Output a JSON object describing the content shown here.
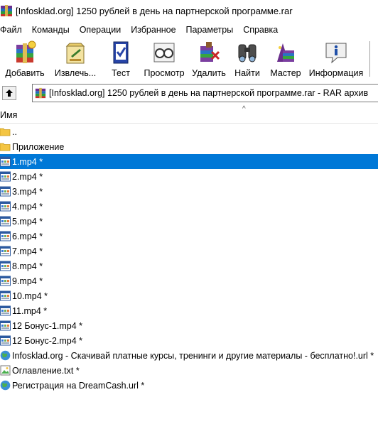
{
  "window": {
    "title": "[Infosklad.org] 1250 рублей в день на партнерской программе.rar"
  },
  "menu": [
    "Файл",
    "Команды",
    "Операции",
    "Избранное",
    "Параметры",
    "Справка"
  ],
  "toolbar": [
    {
      "label": "Добавить",
      "icon": "add-archive-icon"
    },
    {
      "label": "Извлечь...",
      "icon": "extract-icon"
    },
    {
      "label": "Тест",
      "icon": "test-icon"
    },
    {
      "label": "Просмотр",
      "icon": "view-icon"
    },
    {
      "label": "Удалить",
      "icon": "delete-icon"
    },
    {
      "label": "Найти",
      "icon": "find-icon"
    },
    {
      "label": "Мастер",
      "icon": "wizard-icon"
    },
    {
      "label": "Информация",
      "icon": "info-icon"
    }
  ],
  "address": {
    "path": "[Infosklad.org] 1250 рублей в день на партнерской программе.rar - RAR архив"
  },
  "columns": {
    "name": "Имя"
  },
  "files": [
    {
      "name": "..",
      "icon": "folder-icon",
      "selected": false
    },
    {
      "name": "Приложение",
      "icon": "folder-icon",
      "selected": false
    },
    {
      "name": "1.mp4 *",
      "icon": "video-file-icon",
      "selected": true
    },
    {
      "name": "2.mp4 *",
      "icon": "video-file-icon",
      "selected": false
    },
    {
      "name": "3.mp4 *",
      "icon": "video-file-icon",
      "selected": false
    },
    {
      "name": "4.mp4 *",
      "icon": "video-file-icon",
      "selected": false
    },
    {
      "name": "5.mp4 *",
      "icon": "video-file-icon",
      "selected": false
    },
    {
      "name": "6.mp4 *",
      "icon": "video-file-icon",
      "selected": false
    },
    {
      "name": "7.mp4 *",
      "icon": "video-file-icon",
      "selected": false
    },
    {
      "name": "8.mp4 *",
      "icon": "video-file-icon",
      "selected": false
    },
    {
      "name": "9.mp4 *",
      "icon": "video-file-icon",
      "selected": false
    },
    {
      "name": "10.mp4 *",
      "icon": "video-file-icon",
      "selected": false
    },
    {
      "name": "11.mp4 *",
      "icon": "video-file-icon",
      "selected": false
    },
    {
      "name": "12 Бонус-1.mp4 *",
      "icon": "video-file-icon",
      "selected": false
    },
    {
      "name": "12 Бонус-2.mp4 *",
      "icon": "video-file-icon",
      "selected": false
    },
    {
      "name": "Infosklad.org - Скачивай платные курсы, тренинги и другие материалы - бесплатно!.url *",
      "icon": "globe-url-icon",
      "selected": false
    },
    {
      "name": "Оглавление.txt *",
      "icon": "text-file-icon",
      "selected": false
    },
    {
      "name": "Регистрация на DreamCash.url *",
      "icon": "globe-url-icon",
      "selected": false
    }
  ],
  "colors": {
    "selection": "#0078d7"
  }
}
